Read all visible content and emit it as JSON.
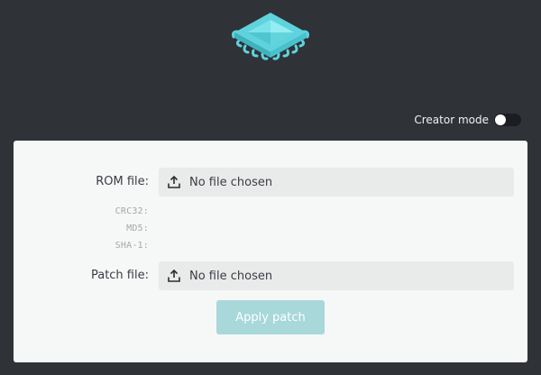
{
  "header": {
    "logo_icon": "chip-icon",
    "creator_mode_label": "Creator mode",
    "creator_mode_on": false
  },
  "form": {
    "rom_label": "ROM file:",
    "rom_value": "No file chosen",
    "hashes": {
      "crc32_label": "CRC32:",
      "md5_label": "MD5:",
      "sha1_label": "SHA-1:"
    },
    "patch_label": "Patch file:",
    "patch_value": "No file chosen",
    "upload_icon": "upload-icon",
    "apply_label": "Apply patch"
  },
  "colors": {
    "background": "#2f3237",
    "card": "#f6f7f7",
    "accent": "#5fd3dd",
    "button": "#a8d8da"
  }
}
